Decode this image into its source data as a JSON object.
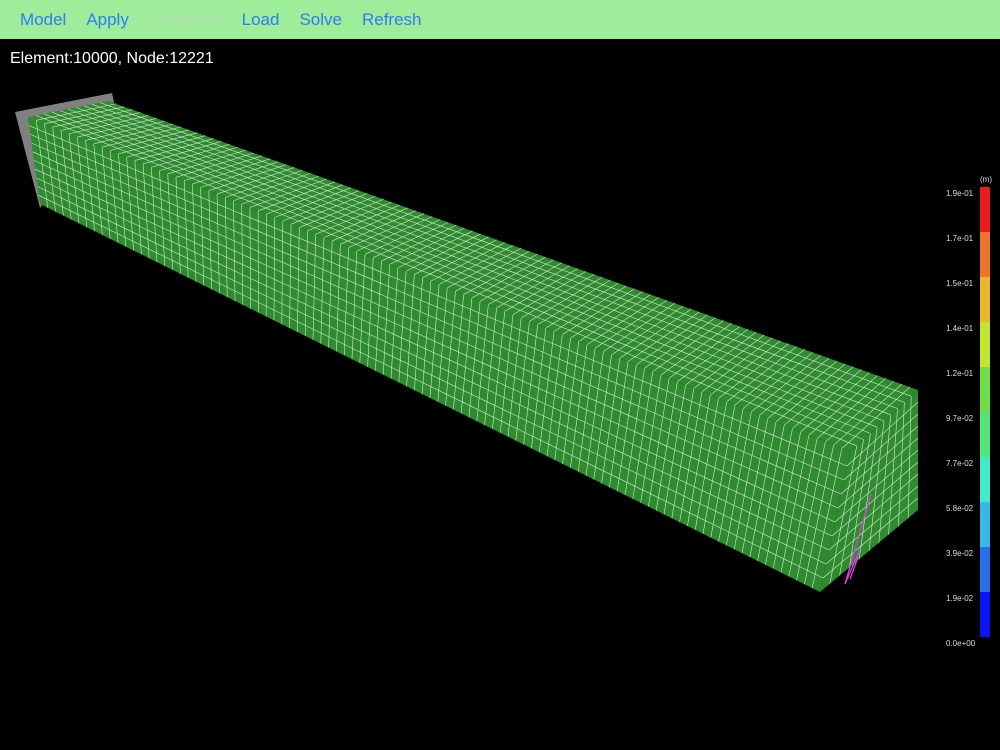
{
  "toolbar": {
    "items": [
      {
        "label": "Model",
        "enabled": true
      },
      {
        "label": "Apply",
        "enabled": true
      },
      {
        "label": "Constrain",
        "enabled": false
      },
      {
        "label": "Load",
        "enabled": true
      },
      {
        "label": "Solve",
        "enabled": true
      },
      {
        "label": "Refresh",
        "enabled": true
      }
    ]
  },
  "info": {
    "text": "Element:10000, Node:12221"
  },
  "model": {
    "mesh_color": "#2e8b2e",
    "grid_color": "#d8e8d8",
    "support_color": "#808080",
    "load_color": "#e040e0"
  },
  "legend": {
    "unit": "(m)",
    "labels": [
      "1.9e-01",
      "1.7e-01",
      "1.5e-01",
      "1.4e-01",
      "1.2e-01",
      "9.7e-02",
      "7.7e-02",
      "5.8e-02",
      "3.9e-02",
      "1.9e-02",
      "0.0e+00"
    ],
    "colors": [
      "#ea1c1c",
      "#ec772a",
      "#ecb72e",
      "#c4e62f",
      "#6ede48",
      "#52e57a",
      "#45e8c8",
      "#37b8e8",
      "#2670e8",
      "#0a14f5"
    ]
  }
}
